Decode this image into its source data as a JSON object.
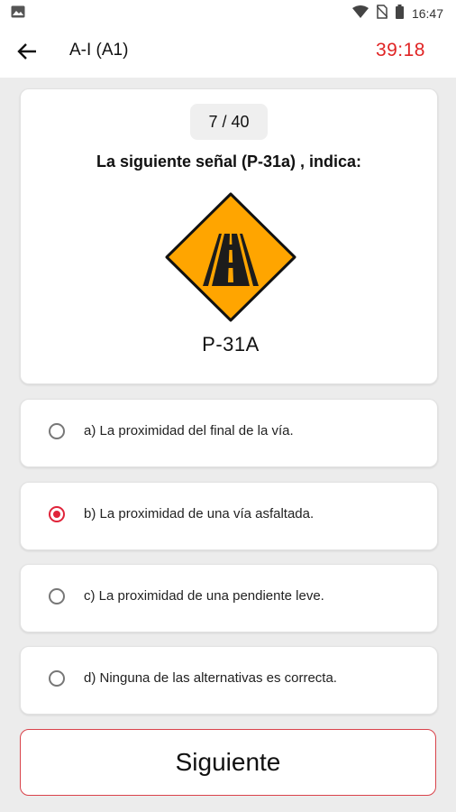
{
  "status_bar": {
    "time": "16:47",
    "icons": [
      "image-icon",
      "wifi-icon",
      "no-sim-icon",
      "battery-icon"
    ]
  },
  "app_bar": {
    "title": "A-I (A1)",
    "timer": "39:18",
    "timer_color": "#e02424"
  },
  "question": {
    "counter": "7 / 40",
    "text": "La siguiente señal (P-31a) , indica:",
    "sign_label": "P-31A",
    "sign_color": "#ffa500"
  },
  "options": [
    {
      "label": "a) La proximidad del final de la vía.",
      "selected": false
    },
    {
      "label": "b) La proximidad de una vía asfaltada.",
      "selected": true
    },
    {
      "label": "c) La proximidad de una pendiente leve.",
      "selected": false
    },
    {
      "label": "d) Ninguna de las alternativas es correcta.",
      "selected": false
    }
  ],
  "accent_color": "#e0243a",
  "next_button": {
    "label": "Siguiente"
  }
}
